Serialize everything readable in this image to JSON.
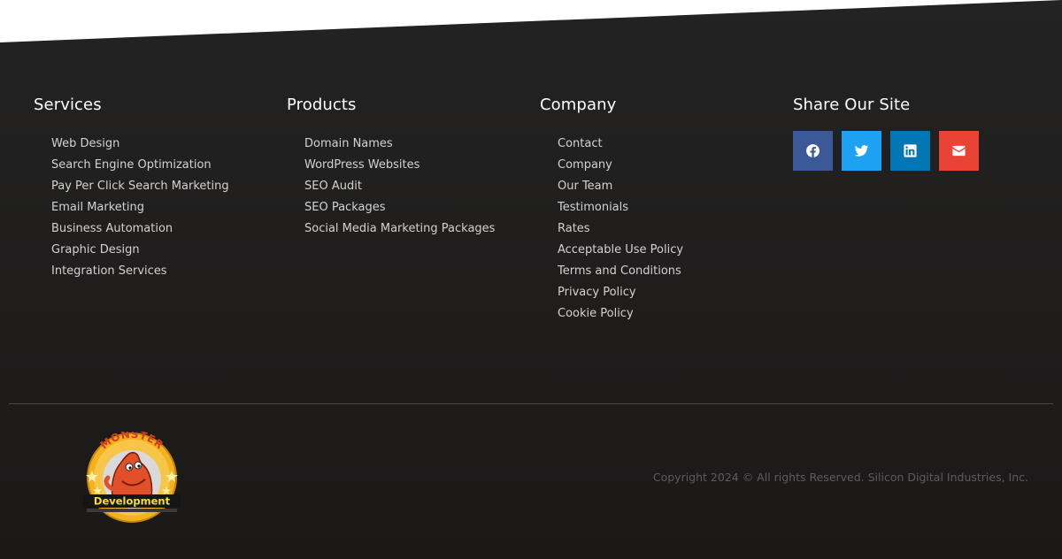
{
  "services": {
    "heading": "Services",
    "items": [
      "Web Design",
      "Search Engine Optimization",
      "Pay Per Click Search Marketing",
      "Email Marketing",
      "Business Automation",
      "Graphic Design",
      "Integration Services"
    ]
  },
  "products": {
    "heading": "Products",
    "items": [
      "Domain Names",
      "WordPress Websites",
      "SEO Audit",
      "SEO Packages",
      "Social Media Marketing Packages"
    ]
  },
  "company": {
    "heading": "Company",
    "items": [
      "Contact",
      "Company",
      "Our Team",
      "Testimonials",
      "Rates",
      "Acceptable Use Policy",
      "Terms and Conditions",
      "Privacy Policy",
      "Cookie Policy"
    ]
  },
  "share": {
    "heading": "Share Our Site",
    "buttons": [
      {
        "icon": "facebook-icon",
        "color": "#3b5998"
      },
      {
        "icon": "twitter-icon",
        "color": "#1da1f2"
      },
      {
        "icon": "linkedin-icon",
        "color": "#0077b5"
      },
      {
        "icon": "email-icon",
        "color": "#ea4335"
      }
    ]
  },
  "logo": {
    "top_text": "MONSTER",
    "bottom_text": "Development"
  },
  "copyright": "Copyright 2024 © All rights Reserved. Silicon Digital Industries, Inc."
}
